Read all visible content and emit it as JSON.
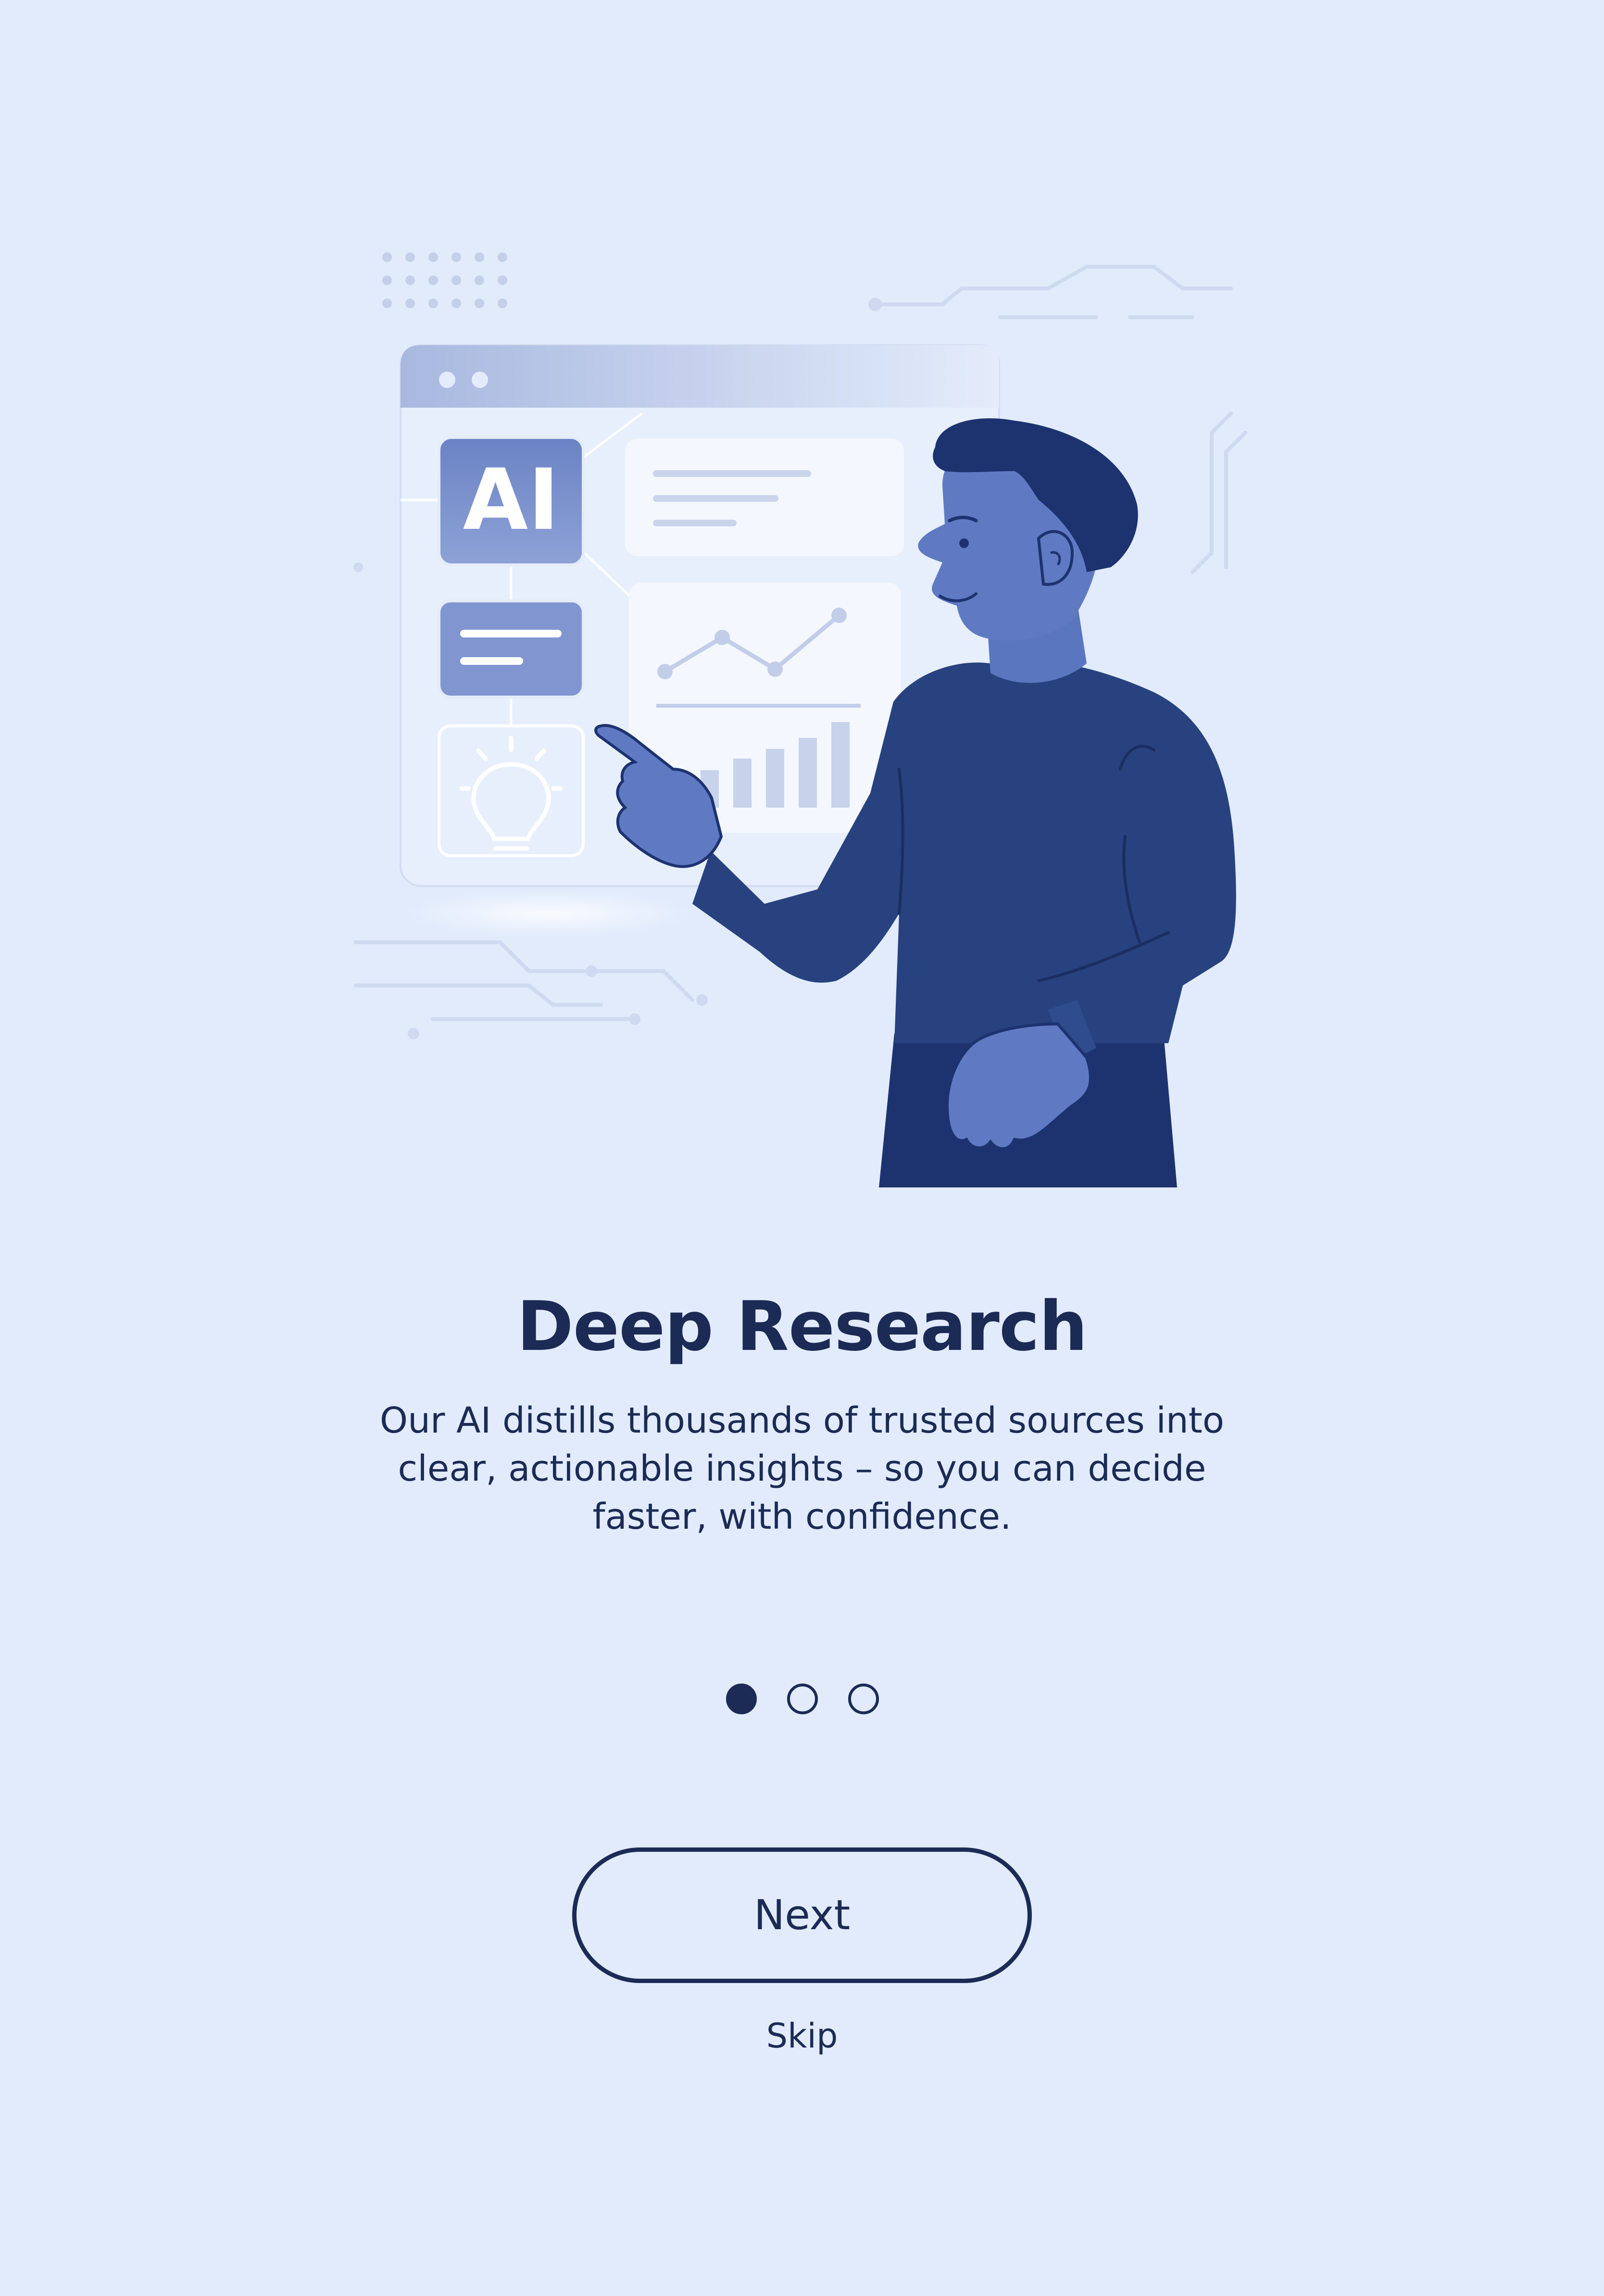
{
  "onboarding": {
    "title": "Deep Research",
    "description": "Our AI distills thousands of trusted sources into clear, actionable insights – so you can decide faster, with confidence.",
    "pager": {
      "total": 3,
      "active_index": 0
    },
    "next_label": "Next",
    "skip_label": "Skip"
  },
  "illustration": {
    "ai_badge_text": "AI",
    "icons": [
      "ai-badge-icon",
      "text-lines-icon",
      "lightbulb-icon",
      "line-chart-icon",
      "bar-chart-icon"
    ]
  },
  "colors": {
    "background": "#E1EBFC",
    "primary": "#1C2B55",
    "accent": "#5E7BC0",
    "shirt": "#27427F"
  }
}
